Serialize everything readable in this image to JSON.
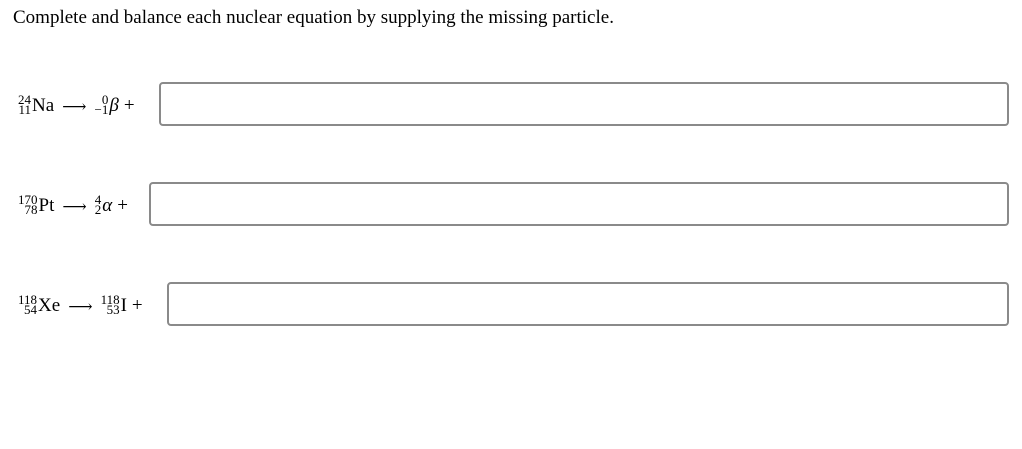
{
  "instructions": "Complete and balance each nuclear equation by supplying the missing particle.",
  "arrow": "⟶",
  "plus": "+",
  "equations": [
    {
      "reactant": {
        "mass": "24",
        "atomic": "11",
        "symbol": "Na"
      },
      "product": {
        "mass": "0",
        "atomic": "−1",
        "symbol": "β"
      },
      "answer_value": ""
    },
    {
      "reactant": {
        "mass": "170",
        "atomic": "78",
        "symbol": "Pt"
      },
      "product": {
        "mass": "4",
        "atomic": "2",
        "symbol": "α"
      },
      "answer_value": ""
    },
    {
      "reactant": {
        "mass": "118",
        "atomic": "54",
        "symbol": "Xe"
      },
      "product": {
        "mass": "118",
        "atomic": "53",
        "symbol": "I"
      },
      "answer_value": ""
    }
  ]
}
